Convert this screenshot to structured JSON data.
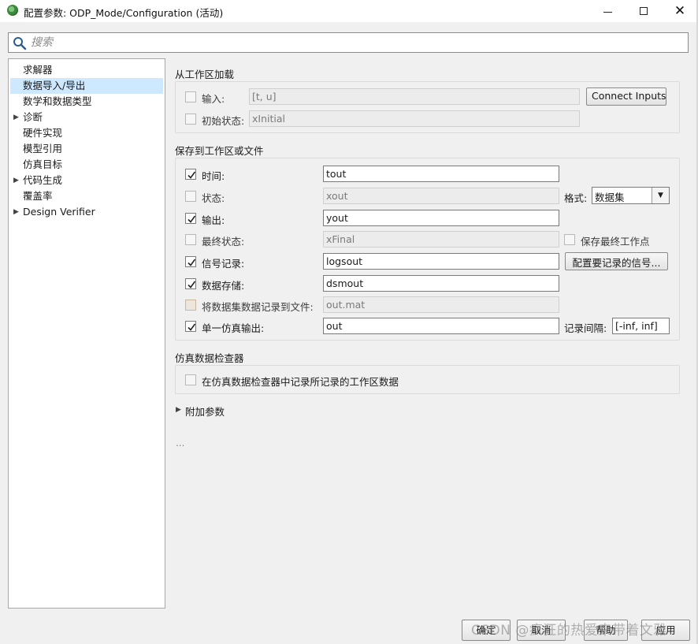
{
  "window": {
    "title": "配置参数: ODP_Mode/Configuration (活动)"
  },
  "search": {
    "placeholder": "搜索"
  },
  "tree": {
    "items": [
      {
        "label": "求解器",
        "expandable": false,
        "selected": false
      },
      {
        "label": "数据导入/导出",
        "expandable": false,
        "selected": true
      },
      {
        "label": "数学和数据类型",
        "expandable": false,
        "selected": false
      },
      {
        "label": "诊断",
        "expandable": true,
        "selected": false
      },
      {
        "label": "硬件实现",
        "expandable": false,
        "selected": false
      },
      {
        "label": "模型引用",
        "expandable": false,
        "selected": false
      },
      {
        "label": "仿真目标",
        "expandable": false,
        "selected": false
      },
      {
        "label": "代码生成",
        "expandable": true,
        "selected": false
      },
      {
        "label": "覆盖率",
        "expandable": false,
        "selected": false
      },
      {
        "label": "Design Verifier",
        "expandable": true,
        "selected": false
      }
    ]
  },
  "load": {
    "title": "从工作区加载",
    "input": {
      "label": "输入:",
      "value": "[t, u]",
      "checked": false
    },
    "connect_button": "Connect Inputs",
    "initial_state": {
      "label": "初始状态:",
      "value": "xInitial",
      "checked": false
    }
  },
  "save": {
    "title": "保存到工作区或文件",
    "time": {
      "label": "时间:",
      "value": "tout",
      "checked": true
    },
    "states": {
      "label": "状态:",
      "value": "xout",
      "checked": false
    },
    "format_label": "格式:",
    "format_value": "数据集",
    "output": {
      "label": "输出:",
      "value": "yout",
      "checked": true
    },
    "final_states": {
      "label": "最终状态:",
      "value": "xFinal",
      "checked": false
    },
    "save_final_operating_point": "保存最终工作点",
    "signal_logging": {
      "label": "信号记录:",
      "value": "logsout",
      "checked": true
    },
    "config_signals_button": "配置要记录的信号...",
    "data_stores": {
      "label": "数据存储:",
      "value": "dsmout",
      "checked": true
    },
    "log_dataset_to_file": {
      "label": "将数据集数据记录到文件:",
      "value": "out.mat",
      "checked": false
    },
    "single_sim_output": {
      "label": "单一仿真输出:",
      "value": "out",
      "checked": true
    },
    "logging_interval_label": "记录间隔:",
    "logging_interval_value": "[-inf, inf]"
  },
  "sdi": {
    "title": "仿真数据检查器",
    "record_label": "在仿真数据检查器中记录所记录的工作区数据",
    "checked": false
  },
  "additional_params_label": "附加参数",
  "ellipsis": "...",
  "buttons": {
    "ok": "确定",
    "cancel": "取消",
    "help": "帮助",
    "apply": "应用"
  },
  "watermark": "CSDN @疯狂的热爱来带着文雅"
}
